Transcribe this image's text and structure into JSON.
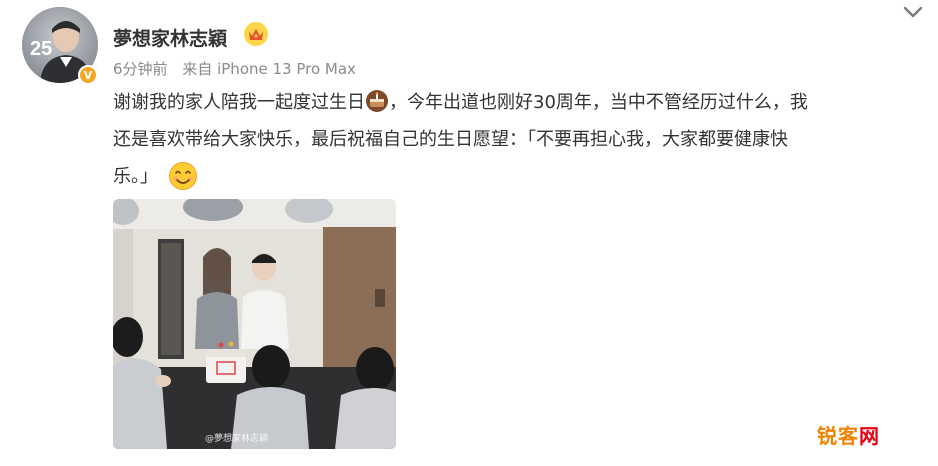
{
  "user": {
    "name": "夢想家林志穎",
    "avatar_overlay": "25"
  },
  "meta": {
    "time": "6分钟前",
    "source": "来自 iPhone 13 Pro Max"
  },
  "post": {
    "line1_before_emoji": "谢谢我的家人陪我一起度过生日",
    "line1_after_emoji": "，今年出道也刚好30周年，当中不管经历过什么，我",
    "line2": "还是喜欢带给大家快乐，最后祝福自己的生日愿望：「不要再担心我，大家都要健康快",
    "line3": "乐。」"
  },
  "photo": {
    "watermark": "@夢想家林志穎"
  },
  "site_logo": {
    "part1": "锐客",
    "part2": "网"
  },
  "icons": {
    "vip_badge": "crown-icon",
    "verified_badge": "verified-badge-icon",
    "cake": "cake-emoji",
    "smile": "smile-emoji",
    "more": "chevron-down-icon"
  },
  "colors": {
    "name": "#333333",
    "meta": "#8a8a8a",
    "verified": "#f5a623",
    "logo_orange": "#f08300"
  }
}
